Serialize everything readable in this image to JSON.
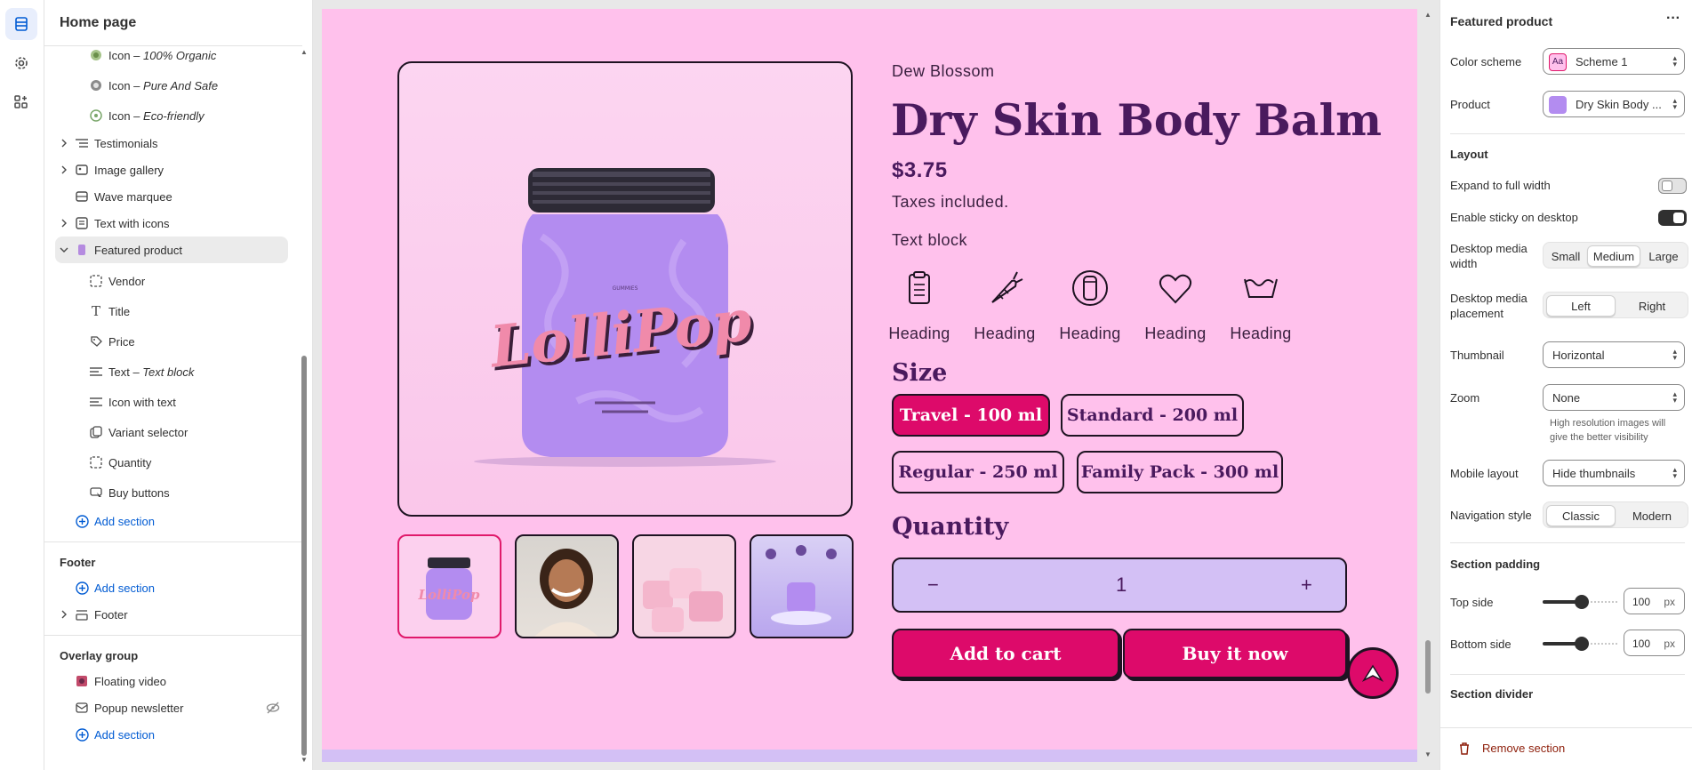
{
  "rail": {
    "icons": [
      "sections-icon",
      "settings-gear-icon",
      "apps-icon"
    ]
  },
  "sidebar": {
    "title": "Home page",
    "items": [
      {
        "prefix": "Icon – ",
        "suffix": "100% Organic"
      },
      {
        "prefix": "Icon – ",
        "suffix": "Pure And Safe"
      },
      {
        "prefix": "Icon – ",
        "suffix": "Eco-friendly"
      },
      {
        "label": "Testimonials"
      },
      {
        "label": "Image gallery"
      },
      {
        "label": "Wave marquee"
      },
      {
        "label": "Text with icons"
      },
      {
        "label": "Featured product"
      },
      {
        "label": "Vendor"
      },
      {
        "label": "Title"
      },
      {
        "label": "Price"
      },
      {
        "prefix": "Text – ",
        "suffix": "Text block"
      },
      {
        "label": "Icon with text"
      },
      {
        "label": "Variant selector"
      },
      {
        "label": "Quantity"
      },
      {
        "label": "Buy buttons"
      }
    ],
    "add_section": "Add section",
    "footer_heading": "Footer",
    "footer_item": "Footer",
    "overlay_heading": "Overlay group",
    "overlay_items": [
      "Floating video",
      "Popup newsletter"
    ]
  },
  "product": {
    "vendor": "Dew Blossom",
    "title": "Dry Skin Body Balm",
    "price": "$3.75",
    "tax_note": "Taxes included.",
    "text_block": "Text block",
    "jar_brand": "LolliPop",
    "icons": [
      {
        "icon": "clipboard-icon",
        "heading": "Heading"
      },
      {
        "icon": "carrot-icon",
        "heading": "Heading"
      },
      {
        "icon": "jar-icon",
        "heading": "Heading"
      },
      {
        "icon": "heart-icon",
        "heading": "Heading"
      },
      {
        "icon": "washing-icon",
        "heading": "Heading"
      }
    ],
    "size_label": "Size",
    "sizes": [
      "Travel - 100 ml",
      "Standard - 200 ml",
      "Regular - 250 ml",
      "Family Pack - 300 ml"
    ],
    "selected_size": "Travel - 100 ml",
    "quantity_label": "Quantity",
    "quantity": "1",
    "minus": "−",
    "plus": "+",
    "add_to_cart": "Add to cart",
    "buy_now": "Buy it now"
  },
  "panel": {
    "title": "Featured product",
    "color_scheme_label": "Color scheme",
    "color_scheme_value": "Scheme 1",
    "product_label": "Product",
    "product_value": "Dry Skin Body ...",
    "layout_heading": "Layout",
    "expand_label": "Expand to full width",
    "expand_on": false,
    "sticky_label": "Enable sticky on desktop",
    "sticky_on": true,
    "media_width_label": "Desktop media width",
    "media_width_options": [
      "Small",
      "Medium",
      "Large"
    ],
    "media_width_selected": "Medium",
    "media_placement_label": "Desktop media placement",
    "media_placement_options": [
      "Left",
      "Right"
    ],
    "media_placement_selected": "Left",
    "thumbnail_label": "Thumbnail",
    "thumbnail_value": "Horizontal",
    "zoom_label": "Zoom",
    "zoom_value": "None",
    "zoom_help": "High resolution images will give the better visibility",
    "mobile_layout_label": "Mobile layout",
    "mobile_layout_value": "Hide thumbnails",
    "nav_style_label": "Navigation style",
    "nav_style_options": [
      "Classic",
      "Modern"
    ],
    "nav_style_selected": "Classic",
    "padding_heading": "Section padding",
    "top_label": "Top side",
    "top_value": "100",
    "bottom_label": "Bottom side",
    "bottom_value": "100",
    "unit": "px",
    "divider_heading": "Section divider",
    "remove_label": "Remove section"
  },
  "colors": {
    "canvas_bg": "#ffc1ec",
    "accent_pink": "#dd0a6a",
    "title_purple": "#4a1a5e",
    "quantity_bg": "#d3c0f5",
    "link_blue": "#005bd3"
  }
}
